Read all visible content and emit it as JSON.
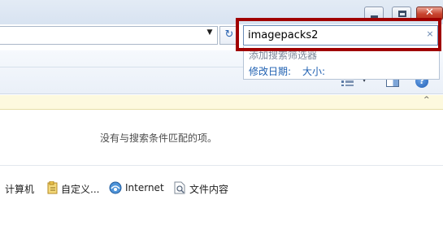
{
  "window_controls": {
    "minimize_icon": "minimize-icon",
    "maximize_icon": "maximize-icon",
    "close_icon": "close-icon",
    "close_glyph": "✕"
  },
  "address": {
    "dropdown_glyph": "▼",
    "refresh_glyph": "↻"
  },
  "search": {
    "value": "imagepacks2",
    "clear_glyph": "×",
    "highlight_color": "#a00000"
  },
  "filters": {
    "add_filter_label": "添加搜索筛选器",
    "date_modified_label": "修改日期:",
    "size_label": "大小:"
  },
  "toolbar": {
    "view_dropdown_glyph": "▼",
    "help_glyph": "?"
  },
  "info_bar": {
    "close_glyph": "^",
    "background": "#fdf9de"
  },
  "content": {
    "no_results": "没有与搜索条件匹配的项。"
  },
  "search_again": {
    "computer_label": "计算机",
    "custom_label": "自定义...",
    "internet_label": "Internet",
    "file_contents_label": "文件内容"
  }
}
